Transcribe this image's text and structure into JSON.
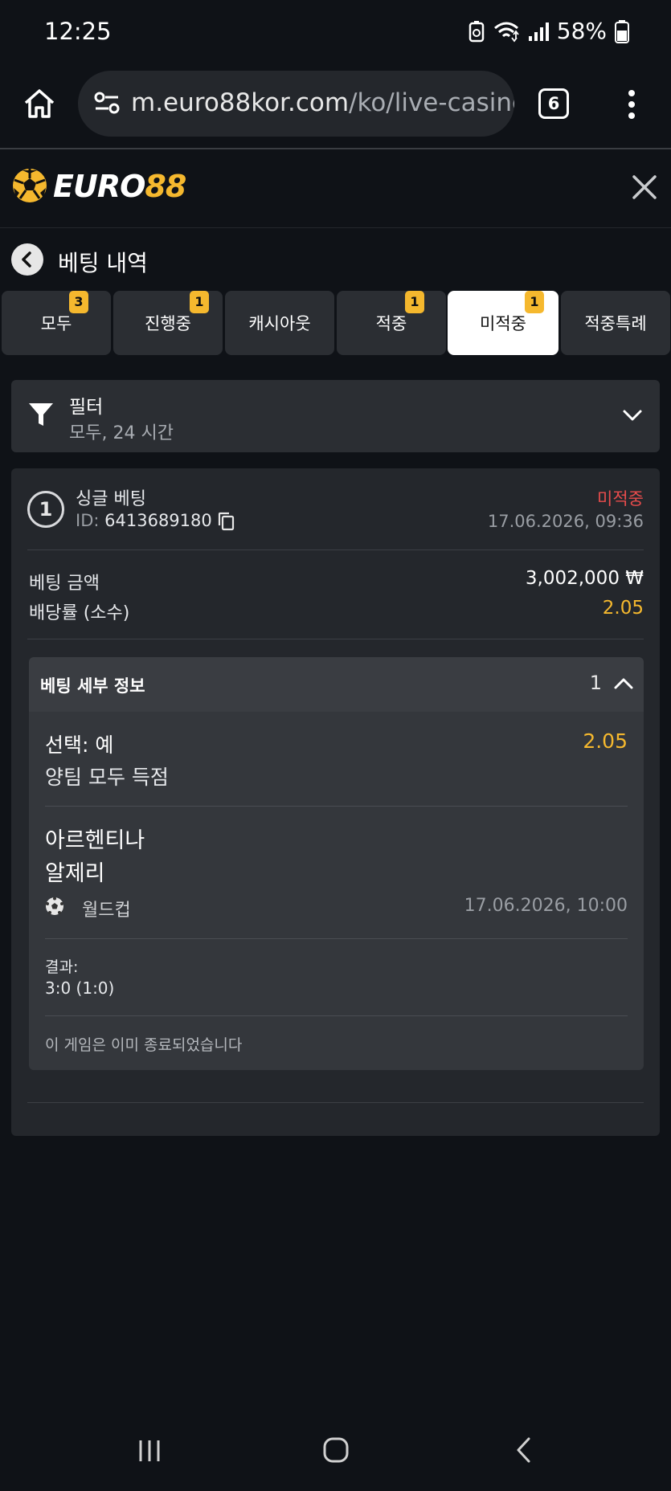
{
  "status_bar": {
    "time": "12:25",
    "battery": "58%"
  },
  "browser": {
    "url_host": "m.euro88kor.com",
    "url_path": "/ko/live-casino",
    "tab_count": "6"
  },
  "site": {
    "logo_part1": "EURO",
    "logo_part2": "88"
  },
  "page": {
    "title": "베팅 내역"
  },
  "tabs": [
    {
      "label": "모두",
      "badge": "3"
    },
    {
      "label": "진행중",
      "badge": "1"
    },
    {
      "label": "캐시아웃",
      "badge": ""
    },
    {
      "label": "적중",
      "badge": "1"
    },
    {
      "label": "미적중",
      "badge": "1",
      "active": true
    },
    {
      "label": "적중특례",
      "badge": ""
    }
  ],
  "filter": {
    "title": "필터",
    "summary": "모두, 24 시간"
  },
  "bet": {
    "number": "1",
    "type": "싱글 베팅",
    "id_label": "ID:",
    "id": "6413689180",
    "status": "미적중",
    "placed_at": "17.06.2026, 09:36",
    "amount_label": "베팅 금액",
    "amount": "3,002,000 ₩",
    "odds_label": "배당률 (소수)",
    "odds": "2.05",
    "details": {
      "title": "베팅 세부 정보",
      "count": "1",
      "selection": "선택: 예",
      "selection_odds": "2.05",
      "market": "양팀 모두 득점",
      "team1": "아르헨티나",
      "team2": "알제리",
      "league": "월드컵",
      "match_time": "17.06.2026, 10:00",
      "result_label": "결과:",
      "result": "3:0 (1:0)",
      "ended_message": "이 게임은 이미 종료되었습니다"
    }
  }
}
